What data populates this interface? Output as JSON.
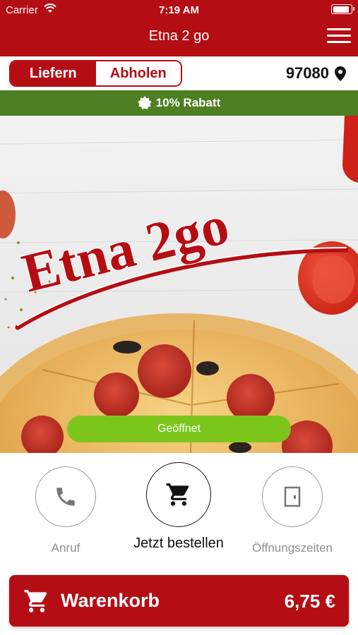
{
  "status_bar": {
    "carrier": "Carrier",
    "time": "7:19 AM"
  },
  "nav": {
    "title": "Etna 2 go",
    "menu_icon": "hamburger-menu-icon"
  },
  "delivery_mode": {
    "options": [
      "Liefern",
      "Abholen"
    ],
    "selected": "Liefern"
  },
  "location": {
    "zip": "97080",
    "icon": "location-pin-icon"
  },
  "discount": {
    "text": "10% Rabatt",
    "icon": "badge-icon"
  },
  "hero": {
    "logo_text": "Etna 2go",
    "status_button": "Geöffnet"
  },
  "actions": [
    {
      "label": "Anruf",
      "icon": "phone-icon"
    },
    {
      "label": "Jetzt bestellen",
      "icon": "cart-icon"
    },
    {
      "label": "Öffnungszeiten",
      "icon": "door-icon"
    }
  ],
  "cart": {
    "label": "Warenkorb",
    "total": "6,75 €",
    "icon": "cart-icon"
  },
  "colors": {
    "brand_red": "#b50d14",
    "discount_green": "#4e7f22",
    "open_green": "#7cc61c"
  }
}
